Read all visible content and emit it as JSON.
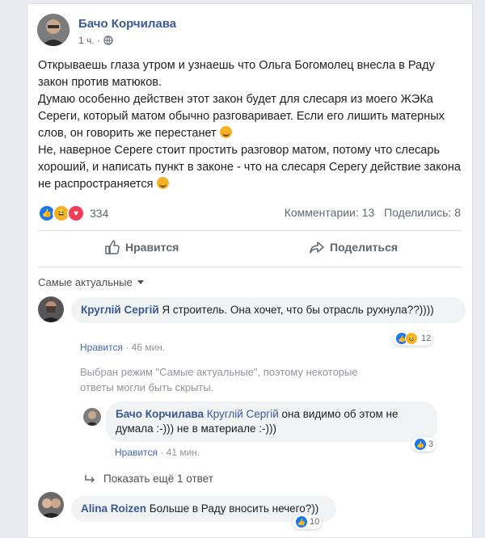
{
  "post": {
    "author": "Бачо Корчилава",
    "time": "1 ч. ·",
    "paragraphs": [
      "Открываешь глаза утром и узнаешь что Ольга Богомолец внесла в Раду закон против матюков.",
      "Думаю особенно действен этот закон будет для слесаря из моего ЖЭКа Сереги, который матом обычно разговаривает. Если его лишить матерных слов, он говорить же перестанет",
      "Не, наверное Сереге стоит простить разговор матом, потому что слесарь хороший, и написать пункт в законе - что на слесаря Серегу действие закона не распространяется"
    ],
    "reactions_count": "334",
    "comments_count": "Комментарии: 13",
    "shares_count": "Поделились: 8",
    "like_label": "Нравится",
    "share_label": "Поделиться"
  },
  "sort": {
    "label": "Самые актуальные"
  },
  "comments": [
    {
      "author": "Круглій Сергій",
      "text": "Я строитель. Она хочет, что бы отрасль рухнула??))))",
      "like_label": "Нравится",
      "time": "46 мин.",
      "reactions": "12"
    },
    {
      "author": "Бачо Корчилава",
      "mention": "Круглій Сергій",
      "text": "она видимо об этом не думала :-))) не в материале :-)))",
      "like_label": "Нравится",
      "time": "41 мин.",
      "reactions": "3"
    },
    {
      "author": "Alina Roizen",
      "text": "Больше в Раду вносить нечего?))",
      "reactions": "10"
    }
  ],
  "notice": "Выбран режим \"Самые актуальные\", поэтому некоторые ответы могли быть скрыты.",
  "show_more": "Показать ещё 1 ответ",
  "colors": {
    "link": "#385898",
    "like_blue": "#1877f2",
    "love_red": "#f33e58",
    "haha_yellow": "#f7b125"
  }
}
